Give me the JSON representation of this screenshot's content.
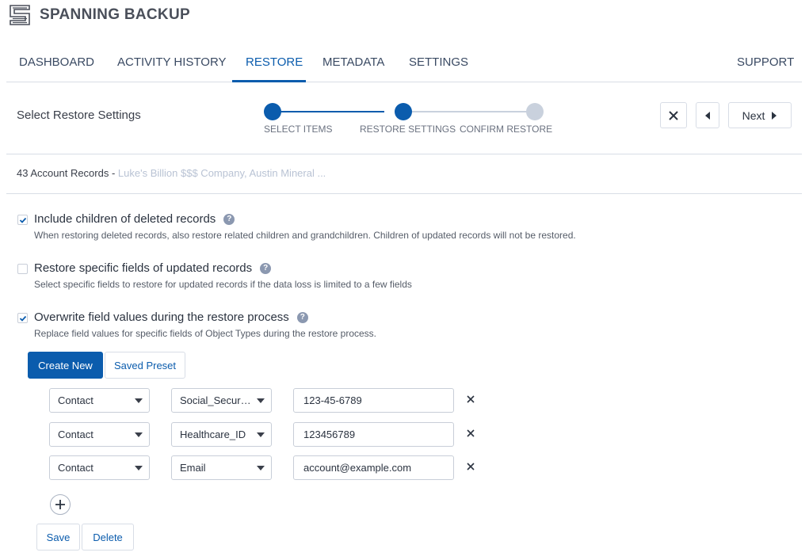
{
  "app": {
    "title": "SPANNING BACKUP",
    "logo_icon": "spanning-logo-icon"
  },
  "nav": {
    "items": [
      "DASHBOARD",
      "ACTIVITY HISTORY",
      "RESTORE",
      "METADATA",
      "SETTINGS"
    ],
    "support": "SUPPORT",
    "active": "RESTORE"
  },
  "stepbar": {
    "title": "Select Restore Settings",
    "steps": [
      {
        "label": "SELECT ITEMS",
        "state": "complete"
      },
      {
        "label": "RESTORE SETTINGS",
        "state": "current"
      },
      {
        "label": "CONFIRM RESTORE",
        "state": "pending"
      }
    ],
    "next_label": "Next"
  },
  "records": {
    "count_label": "43 Account Records -",
    "names": "Luke's Billion $$$ Company, Austin Mineral ..."
  },
  "options": [
    {
      "title": "Include children of deleted records",
      "desc": "When restoring deleted records, also restore related children and grandchildren. Children of updated records will not be restored.",
      "checked": true
    },
    {
      "title": "Restore specific fields of updated records",
      "desc": "Select specific fields to restore for updated records if the data loss is limited to a few fields",
      "checked": false
    },
    {
      "title": "Overwrite field values during the restore process",
      "desc": "Replace field values for specific fields of Object Types during the restore process.",
      "checked": true
    }
  ],
  "help_glyph": "?",
  "preset": {
    "create_new": "Create New",
    "saved_preset": "Saved Preset"
  },
  "rows": [
    {
      "object": "Contact",
      "field": "Social_Security_Number",
      "value": "123-45-6789"
    },
    {
      "object": "Contact",
      "field": "Healthcare_ID",
      "value": "123456789"
    },
    {
      "object": "Contact",
      "field": "Email",
      "value": "account@example.com"
    }
  ],
  "actions": {
    "save": "Save",
    "delete": "Delete"
  },
  "colors": {
    "accent": "#0b5cad",
    "pending": "#c9d1dd",
    "border": "#d8dde6"
  }
}
